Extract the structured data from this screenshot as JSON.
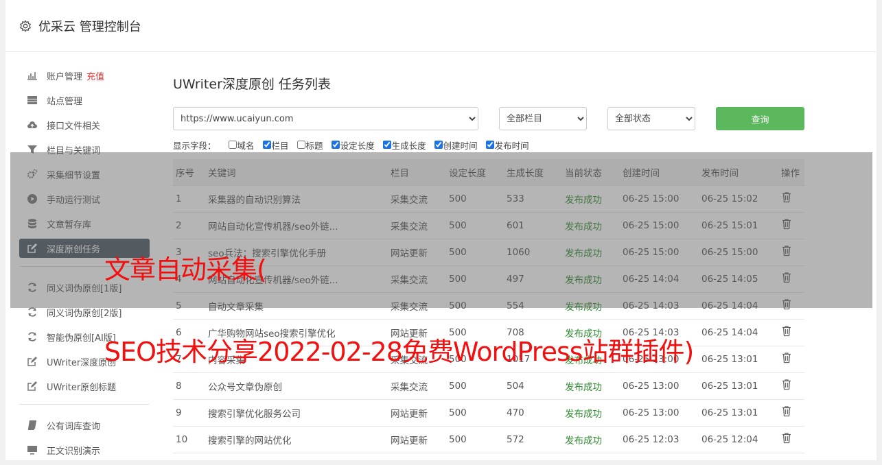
{
  "header": {
    "title": "优采云 管理控制台",
    "icon": "gear-icon"
  },
  "sidebar": {
    "items": [
      {
        "label": "账户管理",
        "badge": "充值",
        "icon": "bar-chart-icon"
      },
      {
        "label": "站点管理",
        "icon": "server-icon"
      },
      {
        "label": "接口文件相关",
        "icon": "cloud-upload-icon"
      },
      {
        "label": "栏目与关键词",
        "icon": "filter-icon"
      },
      {
        "label": "采集细节设置",
        "icon": "gears-icon"
      },
      {
        "label": "手动运行测试",
        "icon": "play-icon"
      },
      {
        "label": "文章暂存库",
        "icon": "database-icon"
      },
      {
        "label": "深度原创任务",
        "icon": "edit-icon",
        "active": true
      },
      {
        "label": "同义词伪原创[1版]",
        "icon": "refresh-icon"
      },
      {
        "label": "同义词伪原创[2版]",
        "icon": "refresh-icon"
      },
      {
        "label": "智能伪原创[AI版]",
        "icon": "refresh-icon"
      },
      {
        "label": "UWriter深度原创",
        "icon": "edit-icon"
      },
      {
        "label": "UWriter原创标题",
        "icon": "edit-icon"
      },
      {
        "label": "公有词库查询",
        "icon": "book-icon"
      },
      {
        "label": "正文识别演示",
        "icon": "monitor-icon"
      }
    ]
  },
  "main": {
    "title": "UWriter深度原创 任务列表",
    "filters": {
      "site": "https://www.ucaiyun.com",
      "column": "全部栏目",
      "status": "全部状态",
      "query_label": "查询"
    },
    "fields_label": "显示字段：",
    "fields": [
      {
        "label": "域名",
        "checked": false
      },
      {
        "label": "栏目",
        "checked": true
      },
      {
        "label": "标题",
        "checked": false
      },
      {
        "label": "设定长度",
        "checked": true
      },
      {
        "label": "生成长度",
        "checked": true
      },
      {
        "label": "创建时间",
        "checked": true
      },
      {
        "label": "发布时间",
        "checked": true
      }
    ],
    "table": {
      "headers": [
        "序号",
        "关键词",
        "栏目",
        "设定长度",
        "生成长度",
        "当前状态",
        "创建时间",
        "发布时间",
        "操作"
      ],
      "rows": [
        [
          "1",
          "采集器的自动识别算法",
          "采集交流",
          "500",
          "533",
          "发布成功",
          "06-25 15:00",
          "06-25 15:02"
        ],
        [
          "2",
          "网站自动化宣传机器/seo外链...",
          "采集交流",
          "500",
          "601",
          "发布成功",
          "06-25 15:00",
          "06-25 15:01"
        ],
        [
          "3",
          "seo兵法：搜索引擎优化手册",
          "网站更新",
          "500",
          "1060",
          "发布成功",
          "06-25 15:00",
          "06-25 15:00"
        ],
        [
          "4",
          "网站自动化宣传机器/seo外链...",
          "采集交流",
          "500",
          "497",
          "发布成功",
          "06-25 14:04",
          "06-25 14:05"
        ],
        [
          "5",
          "自动文章采集",
          "采集交流",
          "500",
          "554",
          "发布成功",
          "06-25 14:03",
          "06-25 14:04"
        ],
        [
          "6",
          "广华购物网站seo搜索引擎优化",
          "网站更新",
          "500",
          "708",
          "发布成功",
          "06-25 14:03",
          "06-25 14:04"
        ],
        [
          "7",
          "内容采集",
          "采集交流",
          "500",
          "1017",
          "发布成功",
          "06-25 13:00",
          "06-25 13:01"
        ],
        [
          "8",
          "公众号文章伪原创",
          "采集交流",
          "500",
          "504",
          "发布成功",
          "06-25 13:00",
          "06-25 13:01"
        ],
        [
          "9",
          "搜索引擎优化服务公司",
          "网站更新",
          "500",
          "470",
          "发布成功",
          "06-25 13:00",
          "06-25 13:01"
        ],
        [
          "10",
          "搜索引擎的网站优化",
          "网站更新",
          "500",
          "572",
          "发布成功",
          "06-25 12:03",
          "06-25 12:04"
        ]
      ]
    }
  },
  "watermark": {
    "line1": "文章自动采集(",
    "line2": "SEO技术分享2022-02-28免费WordPress站群插件)"
  }
}
